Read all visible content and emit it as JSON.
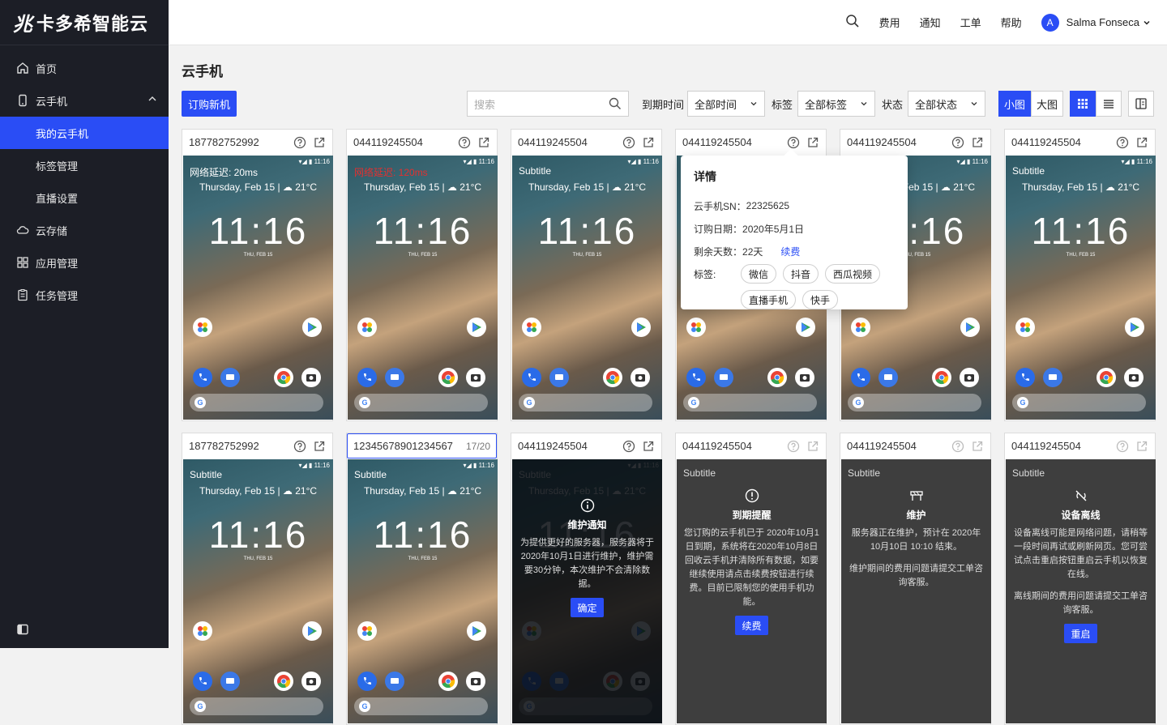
{
  "brand": {
    "mark": "兆",
    "name": "卡多希智能云"
  },
  "sidebar": {
    "items": [
      {
        "label": "首页"
      },
      {
        "label": "云手机"
      },
      {
        "label": "我的云手机"
      },
      {
        "label": "标签管理"
      },
      {
        "label": "直播设置"
      },
      {
        "label": "云存储"
      },
      {
        "label": "应用管理"
      },
      {
        "label": "任务管理"
      }
    ]
  },
  "topbar": {
    "billing": "费用",
    "notify": "通知",
    "ticket": "工单",
    "help": "帮助",
    "avatar_letter": "A",
    "username": "Salma Fonseca"
  },
  "page": {
    "title": "云手机"
  },
  "toolbar": {
    "buy_button": "订购新机",
    "search_placeholder": "搜索",
    "expire_label": "到期时间",
    "expire_value": "全部时间",
    "tag_label": "标签",
    "tag_value": "全部标签",
    "status_label": "状态",
    "status_value": "全部状态",
    "small_view": "小图",
    "large_view": "大图"
  },
  "screen_common": {
    "date": "Thursday, Feb 15 | ☁ 21°C",
    "time": "11:16",
    "date_small": "THU, FEB 15",
    "status": "▾◢ ▮ 11:16"
  },
  "cards_row1": [
    {
      "sn": "187782752992",
      "sub": "网络延迟: 20ms"
    },
    {
      "sn": "044119245504",
      "sub": "网络延迟: 120ms"
    },
    {
      "sn": "044119245504",
      "sub": "Subtitle"
    },
    {
      "sn": "044119245504",
      "sub": ""
    },
    {
      "sn": "044119245504",
      "sub": ""
    },
    {
      "sn": "044119245504",
      "sub": "Subtitle"
    }
  ],
  "cards_row2": [
    {
      "sn": "187782752992",
      "sub": "Subtitle"
    },
    {
      "sn": "12345678901234567",
      "counter": "17/20",
      "sub": "Subtitle"
    },
    {
      "sn": "044119245504",
      "sub": "Subtitle",
      "title": "维护通知",
      "text": "为提供更好的服务器，服务器将于2020年10月1日进行维护，维护需要30分钟，本次维护不会清除数据。",
      "button": "确定"
    },
    {
      "sn": "044119245504",
      "sub": "Subtitle",
      "title": "到期提醒",
      "text": "您订购的云手机已于 2020年10月1日到期，系统将在2020年10月8日回收云手机并清除所有数据，如要继续使用请点击续费按钮进行续费。目前已限制您的使用手机功能。",
      "button": "续费"
    },
    {
      "sn": "044119245504",
      "sub": "Subtitle",
      "title": "维护",
      "text": "服务器正在维护，预计在 2020年10月10日 10:10 结束。",
      "text2": "维护期间的费用问题请提交工单咨询客服。"
    },
    {
      "sn": "044119245504",
      "sub": "Subtitle",
      "title": "设备离线",
      "text": "设备离线可能是网络问题，请稍等一段时间再试或刷新网页。您可尝试点击重启按钮重启云手机以恢复在线。",
      "text2": "离线期间的费用问题请提交工单咨询客服。",
      "button": "重启"
    }
  ],
  "popover": {
    "title": "详情",
    "sn_label": "云手机SN：",
    "sn_value": "22325625",
    "date_label": "订购日期：",
    "date_value": "2020年5月1日",
    "days_label": "剩余天数：",
    "days_value": "22天",
    "renew": "续费",
    "tags_label": "标签:",
    "tags": [
      "微信",
      "抖音",
      "西瓜视频",
      "直播手机",
      "快手"
    ]
  },
  "colors": {
    "accent": "#2a4df5",
    "sidebar_bg": "#1c1e26",
    "warning_red": "#e23030"
  }
}
